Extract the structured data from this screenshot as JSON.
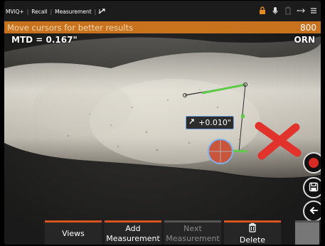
{
  "header": {
    "crumbs": [
      "MViQ+",
      "Recall",
      "Measurement"
    ],
    "icons": [
      "measure-tool-icon",
      "lock-icon",
      "microphone-icon",
      "battery-icon",
      "usb-icon"
    ]
  },
  "instruction": {
    "text": "Move cursors for better results",
    "value": "800"
  },
  "overlay": {
    "mtd": "MTD = 0.167\"",
    "orientation": "ORN",
    "measurement_value": "+0.010\"",
    "accent_color": "#c8721d",
    "reject_color": "#e2322c",
    "line_color": "#5ecb4a"
  },
  "side_buttons": [
    "record-button",
    "save-button",
    "back-button"
  ],
  "softkeys": [
    {
      "line1": "Views",
      "line2": "",
      "enabled": true
    },
    {
      "line1": "Add",
      "line2": "Measurement",
      "enabled": true
    },
    {
      "line1": "Next",
      "line2": "Measurement",
      "enabled": false
    },
    {
      "line1": "",
      "line2": "Delete",
      "enabled": true
    }
  ]
}
